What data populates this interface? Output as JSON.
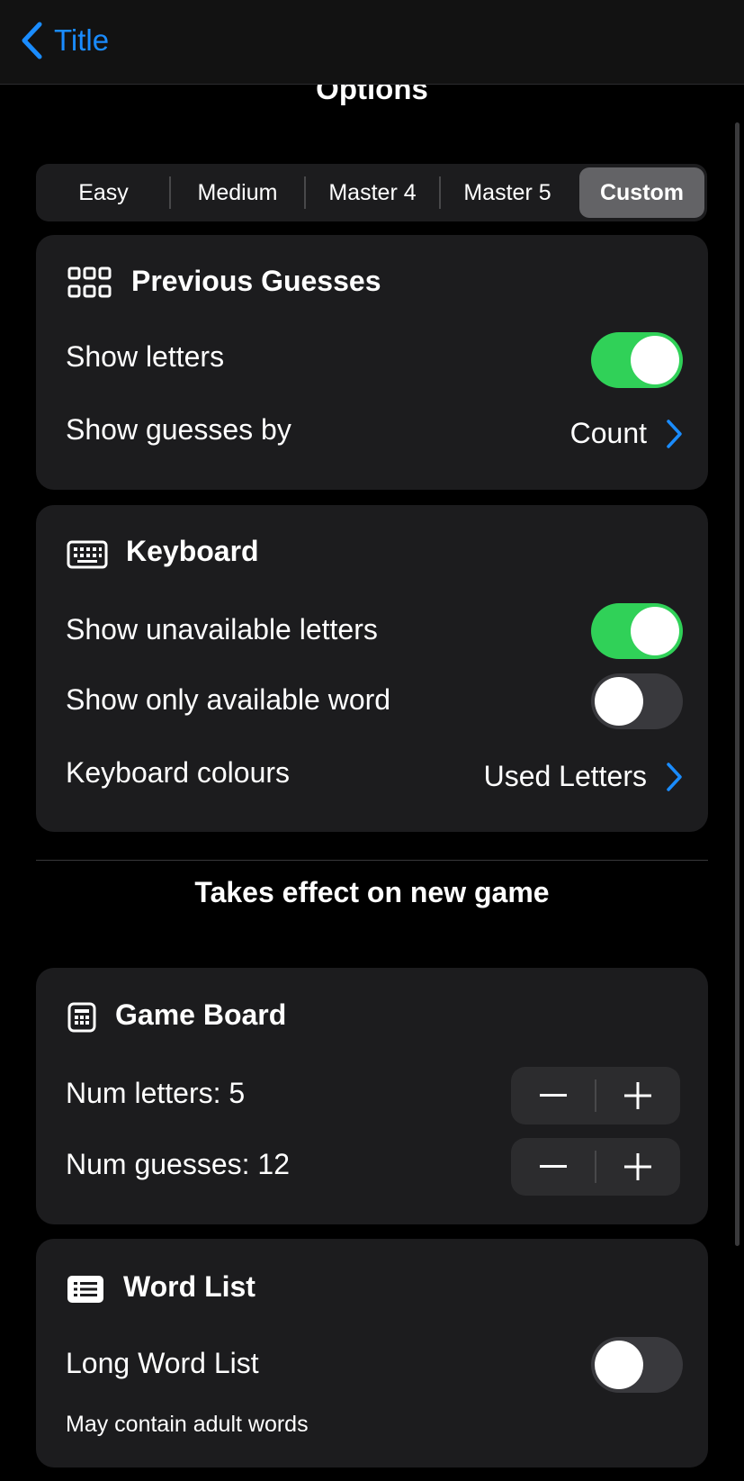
{
  "nav": {
    "back_label": "Title"
  },
  "page": {
    "title": "Options"
  },
  "difficulty": {
    "segments": [
      "Easy",
      "Medium",
      "Master 4",
      "Master 5",
      "Custom"
    ],
    "selected": "Custom"
  },
  "previous_guesses": {
    "title": "Previous Guesses",
    "icon": "grid-icon",
    "show_letters_label": "Show letters",
    "show_letters_on": true,
    "show_guesses_by_label": "Show guesses by",
    "show_guesses_by_value": "Count"
  },
  "keyboard": {
    "title": "Keyboard",
    "icon": "keyboard-icon",
    "show_unavailable_label": "Show unavailable letters",
    "show_unavailable_on": true,
    "show_only_available_label": "Show only available word",
    "show_only_available_on": false,
    "colours_label": "Keyboard colours",
    "colours_value": "Used Letters"
  },
  "takes_effect_note": "Takes effect on new game",
  "game_board": {
    "title": "Game Board",
    "icon": "calculator-grid-icon",
    "num_letters_label": "Num letters: 5",
    "num_guesses_label": "Num guesses: 12"
  },
  "word_list": {
    "title": "Word List",
    "icon": "list-icon",
    "long_word_list_label": "Long Word List",
    "long_word_list_on": false,
    "note": "May contain adult words"
  },
  "colors": {
    "accent": "#1a8cff",
    "toggle_on": "#30d158",
    "card": "#1c1c1e",
    "background": "#000000"
  }
}
